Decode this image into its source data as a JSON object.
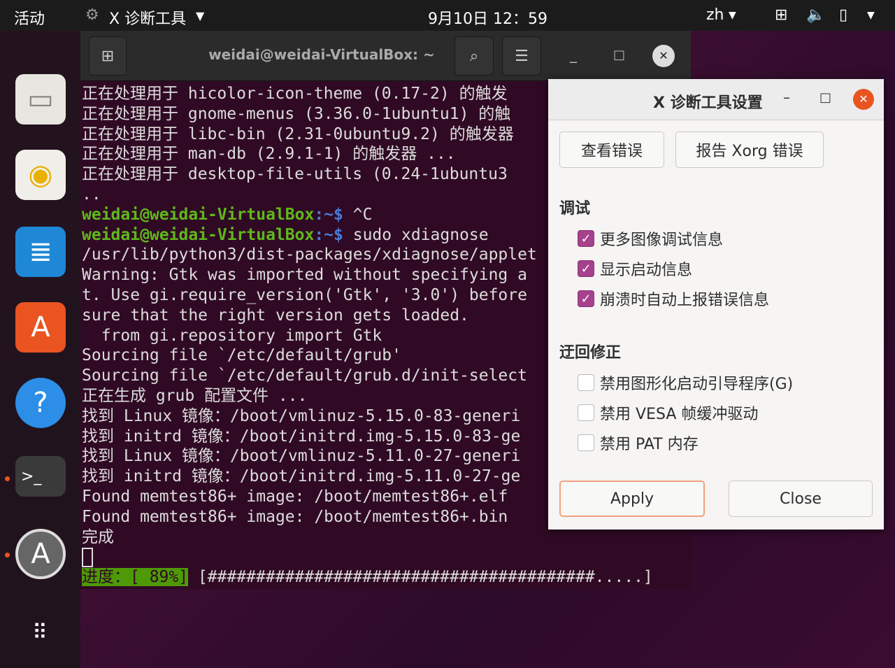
{
  "topbar": {
    "activities": "活动",
    "app_menu": "X 诊断工具",
    "clock": "9月10日  12：59",
    "lang": "zh"
  },
  "terminal": {
    "title": "weidai@weidai-VirtualBox: ~",
    "lines": [
      "正在处理用于 hicolor-icon-theme (0.17-2) 的触发",
      "正在处理用于 gnome-menus (3.36.0-1ubuntu1) 的触",
      "正在处理用于 libc-bin (2.31-0ubuntu9.2) 的触发器",
      "正在处理用于 man-db (2.9.1-1) 的触发器 ...",
      "正在处理用于 desktop-file-utils (0.24-1ubuntu3",
      ".."
    ],
    "prompt_user": "weidai@weidai-VirtualBox",
    "prompt_path": ":~$",
    "cmd1": " ^C",
    "cmd2": " sudo xdiagnose",
    "output": [
      "/usr/lib/python3/dist-packages/xdiagnose/applet",
      "Warning: Gtk was imported without specifying a",
      "t. Use gi.require_version('Gtk', '3.0') before",
      "sure that the right version gets loaded.",
      "  from gi.repository import Gtk",
      "Sourcing file `/etc/default/grub'",
      "Sourcing file `/etc/default/grub.d/init-select",
      "正在生成 grub 配置文件 ...",
      "找到 Linux 镜像：/boot/vmlinuz-5.15.0-83-generi",
      "找到 initrd 镜像：/boot/initrd.img-5.15.0-83-ge",
      "找到 Linux 镜像：/boot/vmlinuz-5.11.0-27-generi",
      "找到 initrd 镜像：/boot/initrd.img-5.11.0-27-ge",
      "Found memtest86+ image: /boot/memtest86+.elf",
      "Found memtest86+ image: /boot/memtest86+.bin",
      "完成"
    ],
    "progress_label": "进度：[ 89%]",
    "progress_percent": 89,
    "progress_bar": " [########################################.....]"
  },
  "dialog": {
    "title": "X 诊断工具设置",
    "view_errors": "查看错误",
    "report_xorg": "报告 Xorg 错误",
    "debug_title": "调试",
    "debug": [
      {
        "label": "更多图像调试信息",
        "checked": true
      },
      {
        "label": "显示启动信息",
        "checked": true
      },
      {
        "label": "崩溃时自动上报错误信息",
        "checked": true
      }
    ],
    "fix_title": "迂回修正",
    "fix": [
      {
        "label": "禁用图形化启动引导程序(G)",
        "checked": false
      },
      {
        "label": "禁用 VESA 帧缓冲驱动",
        "checked": false
      },
      {
        "label": "禁用 PAT 内存",
        "checked": false
      }
    ],
    "apply": "Apply",
    "close": "Close"
  },
  "colors": {
    "accent": "#e95420",
    "checkbox": "#a6418c",
    "terminal_bg": "#300a24",
    "prompt": "#5fb91a"
  }
}
